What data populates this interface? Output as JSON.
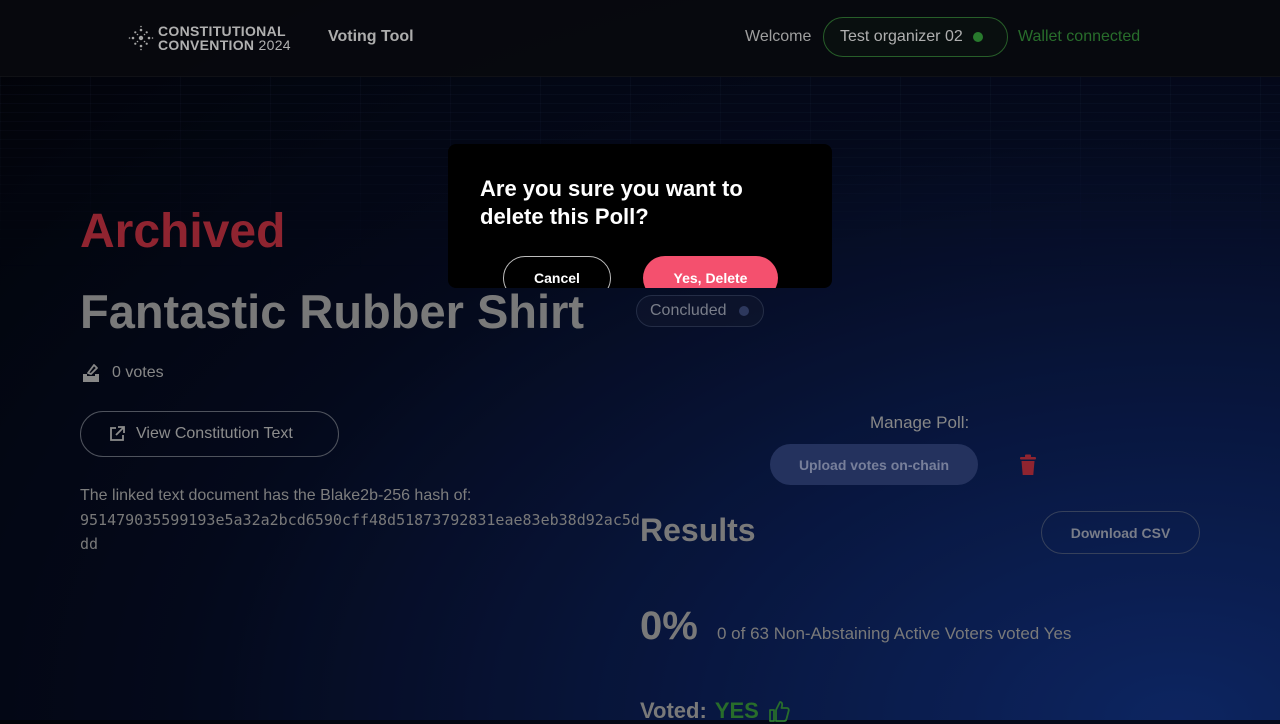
{
  "header": {
    "logo_line1": "CONSTITUTIONAL",
    "logo_line2": "CONVENTION",
    "logo_year": "2024",
    "nav_title": "Voting Tool",
    "welcome": "Welcome",
    "username": "Test organizer 02",
    "wallet_status": "Wallet connected"
  },
  "poll": {
    "status_heading": "Archived",
    "title": "Fantastic Rubber Shirt",
    "state_badge": "Concluded",
    "votes": "0 votes",
    "view_text_button": "View Constitution Text",
    "hash_label": "The linked text document has the Blake2b-256 hash of:",
    "hash_value": "951479035599193e5a32a2bcd6590cff48d51873792831eae83eb38d92ac5ddd"
  },
  "manage": {
    "label": "Manage Poll:",
    "upload_button": "Upload votes on-chain"
  },
  "results": {
    "title": "Results",
    "download_button": "Download CSV",
    "percent": "0%",
    "summary": "0 of 63 Non-Abstaining Active Voters voted Yes",
    "voted_label": "Voted:",
    "voted_value": "YES"
  },
  "dialog": {
    "title": "Are you sure you want to delete this Poll?",
    "cancel": "Cancel",
    "confirm": "Yes, Delete"
  },
  "colors": {
    "archived_red": "#a32937",
    "wallet_green": "#2e7d32",
    "delete_pink": "#f4506e",
    "upload_blue": "#2a3a6c"
  },
  "icons": [
    "sunburst-logo-icon",
    "ballot-icon",
    "external-link-icon",
    "trash-icon",
    "thumbs-up-icon"
  ]
}
